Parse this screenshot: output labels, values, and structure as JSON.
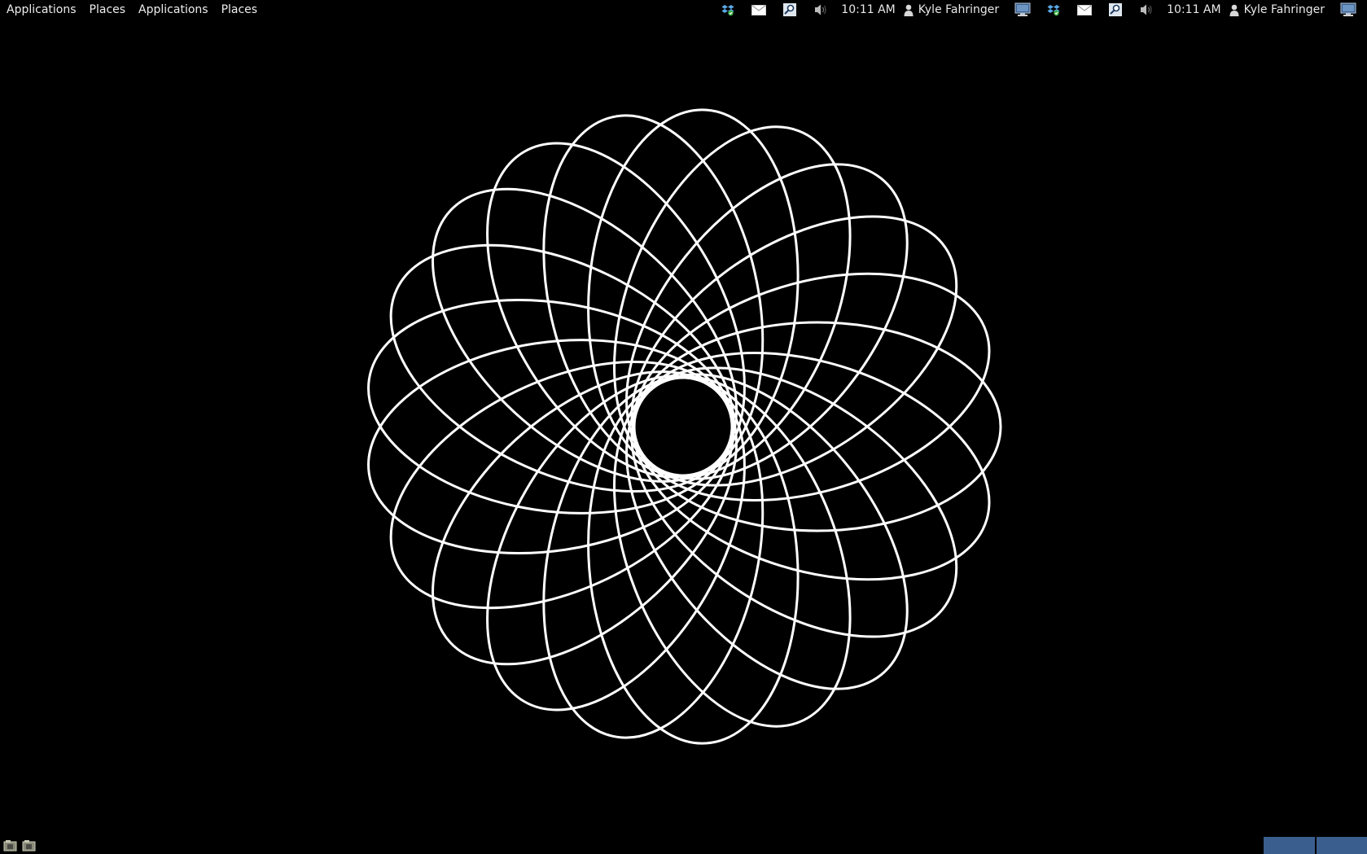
{
  "top_panel": {
    "menus": [
      "Applications",
      "Places",
      "Applications",
      "Places"
    ],
    "tray": [
      {
        "icons": [
          "dropbox-icon",
          "mail-icon",
          "search-icon",
          "volume-icon"
        ],
        "clock": "10:11 AM",
        "user": "Kyle Fahringer",
        "end_icon": "monitor-icon"
      },
      {
        "icons": [
          "dropbox-icon",
          "mail-icon",
          "search-icon",
          "volume-icon"
        ],
        "clock": "10:11 AM",
        "user": "Kyle Fahringer",
        "end_icon": "monitor-icon"
      }
    ]
  },
  "desktop": {
    "wallpaper": "spirograph",
    "background_color": "#000000",
    "line_color": "#ffffff"
  },
  "bottom_panel": {
    "launchers": [
      "show-desktop-icon",
      "show-desktop-icon"
    ],
    "workspace_color": "#3a5f8f",
    "workspaces": 2
  }
}
